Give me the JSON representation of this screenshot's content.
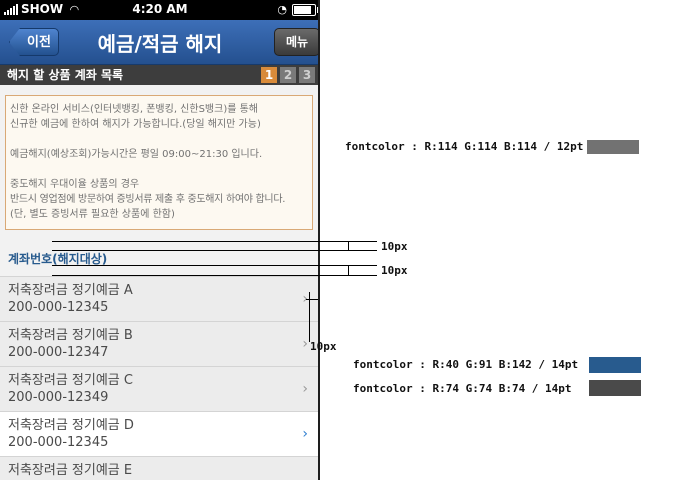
{
  "status_bar": {
    "carrier": "SHOW",
    "time": "4:20 AM"
  },
  "nav": {
    "back_label": "이전",
    "title": "예금/적금  해지",
    "menu_label": "메뉴"
  },
  "section": {
    "title": "해지 할 상품 계좌 목록",
    "steps": [
      "1",
      "2",
      "3"
    ],
    "active_step": 1
  },
  "notice": {
    "lines": [
      "신한 온라인 서비스(인터넷뱅킹, 폰뱅킹, 신한S뱅크)를 통해",
      "신규한 예금에 한하여 해지가 가능합니다.(당일 해지만 가능)",
      "",
      "예금해지(예상조회)가능시간은 평일 09:00~21:30 입니다.",
      "",
      "중도해지 우대이율 상품의 경우",
      "반드시 영업점에 방문하여 증빙서류 제출 후 중도해지 하여야 합니다.",
      "(단, 별도 증빙서류 필요한 상품에 한함)"
    ]
  },
  "account_header": "계좌번호(해지대상)",
  "accounts": [
    {
      "name": "저축장려금 정기예금 A",
      "number": "200-000-12345",
      "selected": false
    },
    {
      "name": "저축장려금 정기예금 B",
      "number": "200-000-12347",
      "selected": false
    },
    {
      "name": "저축장려금 정기예금 C",
      "number": "200-000-12349",
      "selected": false
    },
    {
      "name": "저축장려금 정기예금 D",
      "number": "200-000-12345",
      "selected": true
    },
    {
      "name": "저축장려금 정기예금 E",
      "number": "",
      "selected": false
    }
  ],
  "annotations": {
    "notice_font": "fontcolor : R:114 G:114 B:114 / 12pt",
    "spacing_1": "10px",
    "spacing_2": "10px",
    "spacing_3": "10px",
    "blue_font": "fontcolor : R:40 G:91 B:142 / 14pt",
    "dark_font": "fontcolor : R:74 G:74 B:74 / 14pt"
  },
  "colors": {
    "notice_gray": "#727272",
    "blue": "#285b8e",
    "dark": "#4a4a4a",
    "step_active": "#d98b3a"
  }
}
